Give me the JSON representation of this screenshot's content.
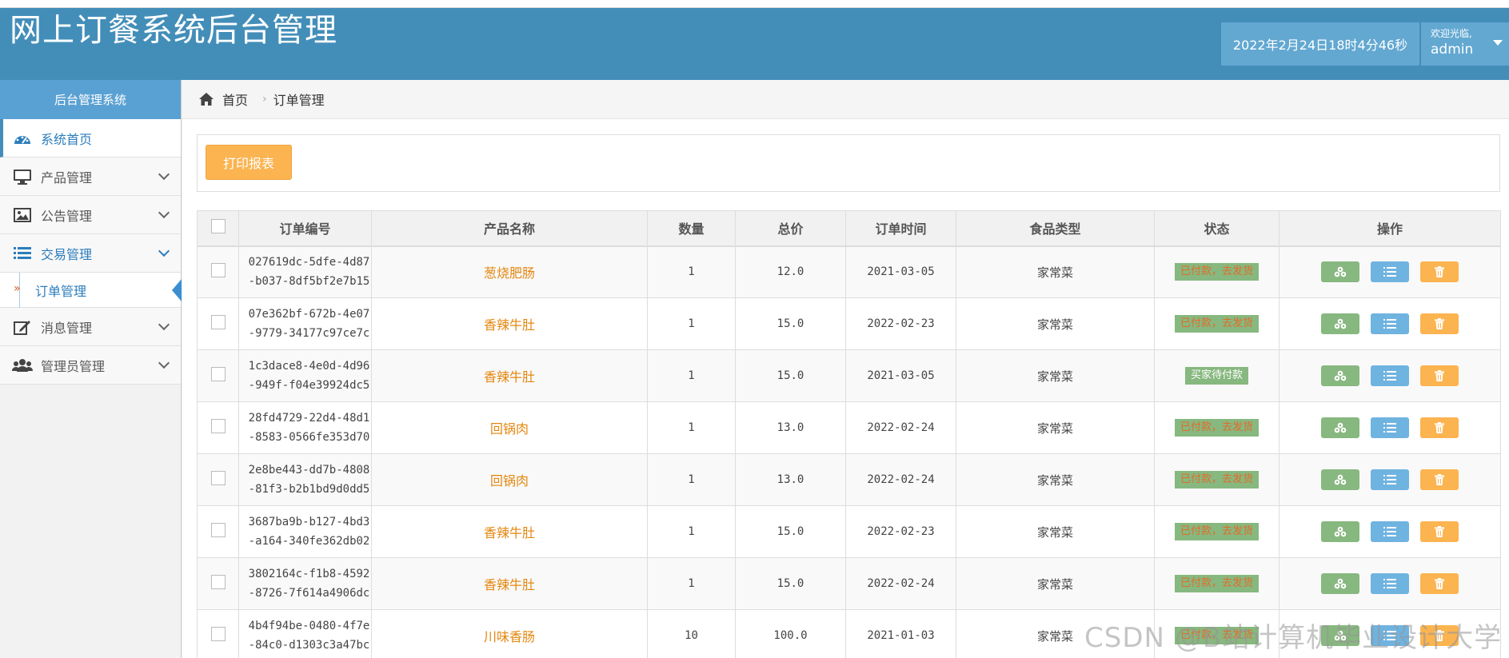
{
  "app": {
    "title": "网上订餐系统后台管理"
  },
  "header": {
    "datetime": "2022年2月24日18时4分46秒",
    "welcome": "欢迎光临,",
    "username": "admin"
  },
  "sidebar": {
    "title": "后台管理系统",
    "items": [
      {
        "label": "系统首页",
        "icon": "dashboard-icon",
        "active": true
      },
      {
        "label": "产品管理",
        "icon": "desktop-icon"
      },
      {
        "label": "公告管理",
        "icon": "picture-icon"
      },
      {
        "label": "交易管理",
        "icon": "list-icon"
      },
      {
        "label": "消息管理",
        "icon": "edit-icon"
      },
      {
        "label": "管理员管理",
        "icon": "users-icon"
      }
    ],
    "subitem": {
      "label": "订单管理",
      "arrow": "»"
    }
  },
  "breadcrumb": {
    "home": "首页",
    "separator": "›",
    "current": "订单管理"
  },
  "toolbar": {
    "print_label": "打印报表"
  },
  "table": {
    "headers": [
      "订单编号",
      "产品名称",
      "数量",
      "总价",
      "订单时间",
      "食品类型",
      "状态",
      "操作"
    ],
    "rows": [
      {
        "id1": "027619dc-5dfe-4d87",
        "id2": "-b037-8df5bf2e7b15",
        "product": "葱烧肥肠",
        "qty": "1",
        "total": "12.0",
        "date": "2021-03-05",
        "type": "家常菜",
        "status": "已付款，去发货",
        "status_kind": "paid"
      },
      {
        "id1": "07e362bf-672b-4e07",
        "id2": "-9779-34177c97ce7c",
        "product": "香辣牛肚",
        "qty": "1",
        "total": "15.0",
        "date": "2022-02-23",
        "type": "家常菜",
        "status": "已付款，去发货",
        "status_kind": "paid"
      },
      {
        "id1": "1c3dace8-4e0d-4d96",
        "id2": "-949f-f04e39924dc5",
        "product": "香辣牛肚",
        "qty": "1",
        "total": "15.0",
        "date": "2021-03-05",
        "type": "家常菜",
        "status": "买家待付款",
        "status_kind": "unpaid"
      },
      {
        "id1": "28fd4729-22d4-48d1",
        "id2": "-8583-0566fe353d70",
        "product": "回锅肉",
        "qty": "1",
        "total": "13.0",
        "date": "2022-02-24",
        "type": "家常菜",
        "status": "已付款，去发货",
        "status_kind": "paid"
      },
      {
        "id1": "2e8be443-dd7b-4808",
        "id2": "-81f3-b2b1bd9d0dd5",
        "product": "回锅肉",
        "qty": "1",
        "total": "13.0",
        "date": "2022-02-24",
        "type": "家常菜",
        "status": "已付款，去发货",
        "status_kind": "paid"
      },
      {
        "id1": "3687ba9b-b127-4bd3",
        "id2": "-a164-340fe362db02",
        "product": "香辣牛肚",
        "qty": "1",
        "total": "15.0",
        "date": "2022-02-23",
        "type": "家常菜",
        "status": "已付款，去发货",
        "status_kind": "paid"
      },
      {
        "id1": "3802164c-f1b8-4592",
        "id2": "-8726-7f614a4906dc",
        "product": "香辣牛肚",
        "qty": "1",
        "total": "15.0",
        "date": "2022-02-24",
        "type": "家常菜",
        "status": "已付款，去发货",
        "status_kind": "paid"
      },
      {
        "id1": "4b4f94be-0480-4f7e",
        "id2": "-84c0-d1303c3a47bc",
        "product": "川味香肠",
        "qty": "10",
        "total": "100.0",
        "date": "2021-01-03",
        "type": "家常菜",
        "status": "已付款，去发货",
        "status_kind": "paid"
      }
    ],
    "actions": [
      {
        "icon": "view-icon",
        "color": "#87b87f"
      },
      {
        "icon": "detail-list-icon",
        "color": "#6fb3e0"
      },
      {
        "icon": "trash-icon",
        "color": "#fbb450"
      }
    ]
  },
  "watermark": "CSDN @B站计算机毕业设计大学"
}
